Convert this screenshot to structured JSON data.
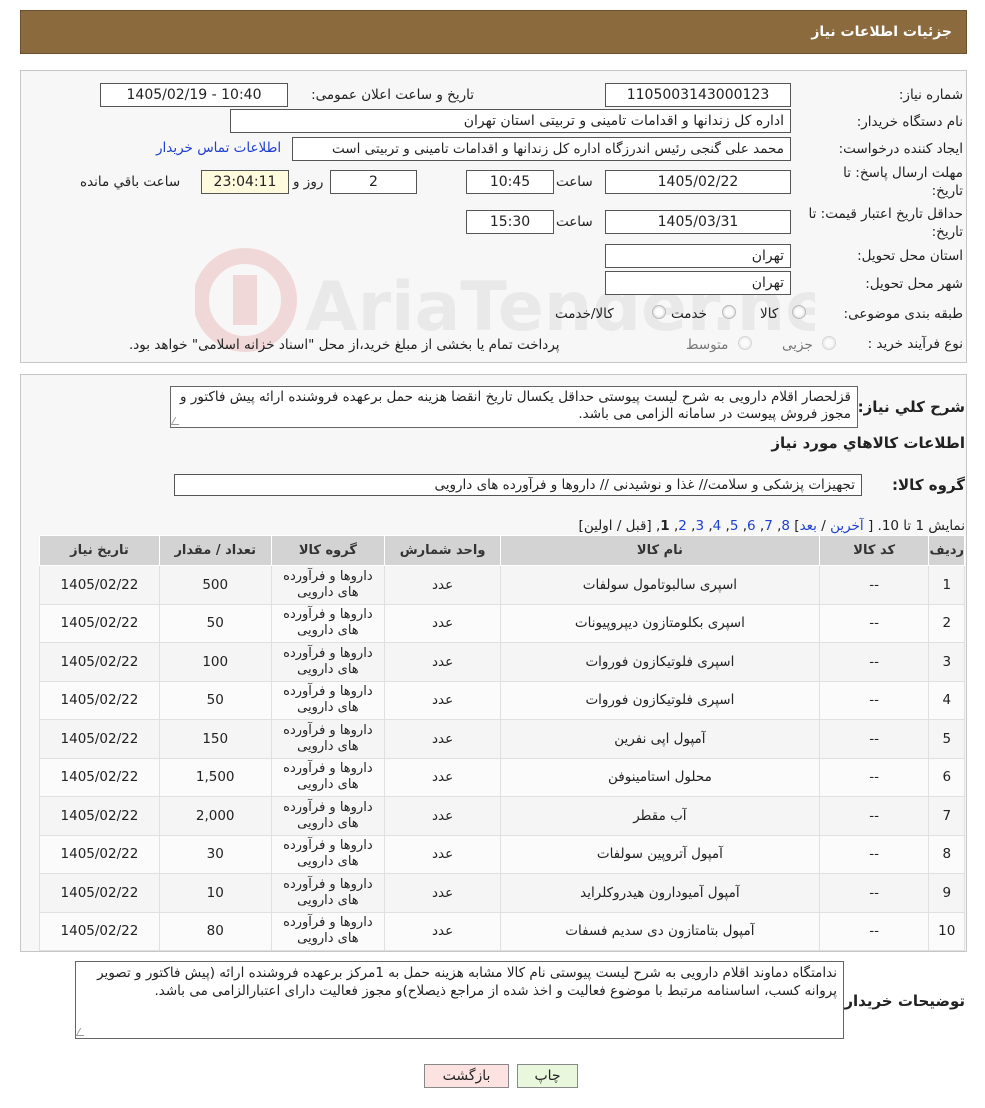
{
  "header": {
    "title": "جزئیات اطلاعات نیاز"
  },
  "form": {
    "need_number_label": "شماره نیاز:",
    "need_number": "1105003143000123",
    "announce_label": "تاریخ و ساعت اعلان عمومی:",
    "announce_value": "1405/02/19 - 10:40",
    "buyer_label": "نام دستگاه خریدار:",
    "buyer_value": "اداره کل زندانها و اقدامات تامینی و تربیتی استان تهران",
    "creator_label": "ایجاد کننده درخواست:",
    "creator_value": "محمد علی گنجی رئیس اندرزگاه  اداره کل زندانها و اقدامات تامینی و تربیتی است",
    "contact_link": "اطلاعات تماس خریدار",
    "deadline_label_1": "مهلت ارسال پاسخ: تا",
    "deadline_label_2": "تاریخ:",
    "deadline_date": "1405/02/22",
    "time_label": "ساعت",
    "deadline_time": "10:45",
    "days_value": "2",
    "days_label": "روز و",
    "remaining_time": "23:04:11",
    "remaining_label": "ساعت باقي مانده",
    "validity_label_1": "حداقل تاریخ اعتبار قیمت: تا",
    "validity_label_2": "تاریخ:",
    "validity_date": "1405/03/31",
    "validity_time": "15:30",
    "province_label": "استان محل تحویل:",
    "province_value": "تهران",
    "city_label": "شهر محل تحویل:",
    "city_value": "تهران",
    "category_label": "طبقه بندی موضوعی:",
    "category_options": [
      "کالا",
      "خدمت",
      "کالا/خدمت"
    ],
    "process_label": "نوع فرآیند خرید :",
    "process_options": [
      "جزیی",
      "متوسط"
    ],
    "process_note": "پرداخت تمام یا بخشی از مبلغ خرید،از محل \"اسناد خزانه اسلامی\" خواهد بود."
  },
  "description": {
    "label": "شرح کلي نياز:",
    "text": "قزلحصار اقلام دارویی به شرح لیست پیوستی حداقل یکسال تاریخ انقضا هزینه حمل برعهده فروشنده ارائه پیش فاکتور و مجوز فروش پیوست در سامانه الزامی می باشد.",
    "items_title": "اطلاعات كالاهاي مورد نياز",
    "group_label": "گروه کالا:",
    "group_value": "تجهیزات پزشکی و سلامت// غذا و نوشیدنی // داروها و فرآورده های دارویی"
  },
  "pagination": {
    "prefix": "نمایش 1 تا 10.  [",
    "last": "آخرین",
    "next": "بعد",
    "pages": [
      "8",
      "7",
      "6",
      "5",
      "4",
      "3",
      "2"
    ],
    "current": "1",
    "suffix": "[قبل / اولین]"
  },
  "table": {
    "headers": [
      "ردیف",
      "کد کالا",
      "نام کالا",
      "واحد شمارش",
      "گروه کالا",
      "تعداد / مقدار",
      "تاریخ نیاز"
    ],
    "rows": [
      [
        "1",
        "--",
        "اسپری سالبوتامول سولفات",
        "عدد",
        "داروها و فرآورده های دارویی",
        "500",
        "1405/02/22"
      ],
      [
        "2",
        "--",
        "اسپری بکلومتازون دیپروپیونات",
        "عدد",
        "داروها و فرآورده های دارویی",
        "50",
        "1405/02/22"
      ],
      [
        "3",
        "--",
        "اسپری فلوتیکازون فوروات",
        "عدد",
        "داروها و فرآورده های دارویی",
        "100",
        "1405/02/22"
      ],
      [
        "4",
        "--",
        "اسپری فلوتیکازون فوروات",
        "عدد",
        "داروها و فرآورده های دارویی",
        "50",
        "1405/02/22"
      ],
      [
        "5",
        "--",
        "آمپول اپی نفرین",
        "عدد",
        "داروها و فرآورده های دارویی",
        "150",
        "1405/02/22"
      ],
      [
        "6",
        "--",
        "محلول استامینوفن",
        "عدد",
        "داروها و فرآورده های دارویی",
        "1,500",
        "1405/02/22"
      ],
      [
        "7",
        "--",
        "آب مقطر",
        "عدد",
        "داروها و فرآورده های دارویی",
        "2,000",
        "1405/02/22"
      ],
      [
        "8",
        "--",
        "آمپول آتروپین سولفات",
        "عدد",
        "داروها و فرآورده های دارویی",
        "30",
        "1405/02/22"
      ],
      [
        "9",
        "--",
        "آمپول آمیودارون هیدروکلراید",
        "عدد",
        "داروها و فرآورده های دارویی",
        "10",
        "1405/02/22"
      ],
      [
        "10",
        "--",
        "آمپول بتامتازون دی سدیم فسفات",
        "عدد",
        "داروها و فرآورده های دارویی",
        "80",
        "1405/02/22"
      ]
    ]
  },
  "buyer_notes": {
    "label": "توضیحات خریدار:",
    "text": "ندامتگاه دماوند اقلام دارویی به شرح لیست پیوستی نام کالا مشابه هزینه حمل به 1مرکز برعهده فروشنده ارائه (پیش فاکتور و  تصویر پروانه کسب، اساسنامه مرتبط با موضوع فعالیت و اخذ شده از مراجع ذیصلاح)و مجوز فعالیت دارای اعتبارالزامی می باشد."
  },
  "buttons": {
    "print": "چاپ",
    "back": "بازگشت"
  },
  "watermark": "AriaTender.neT",
  "colors": {
    "header_bg": "#8b6a3e",
    "link": "#1f3fd1",
    "print_bg": "#e9f7dc",
    "back_bg": "#fde2e2"
  }
}
